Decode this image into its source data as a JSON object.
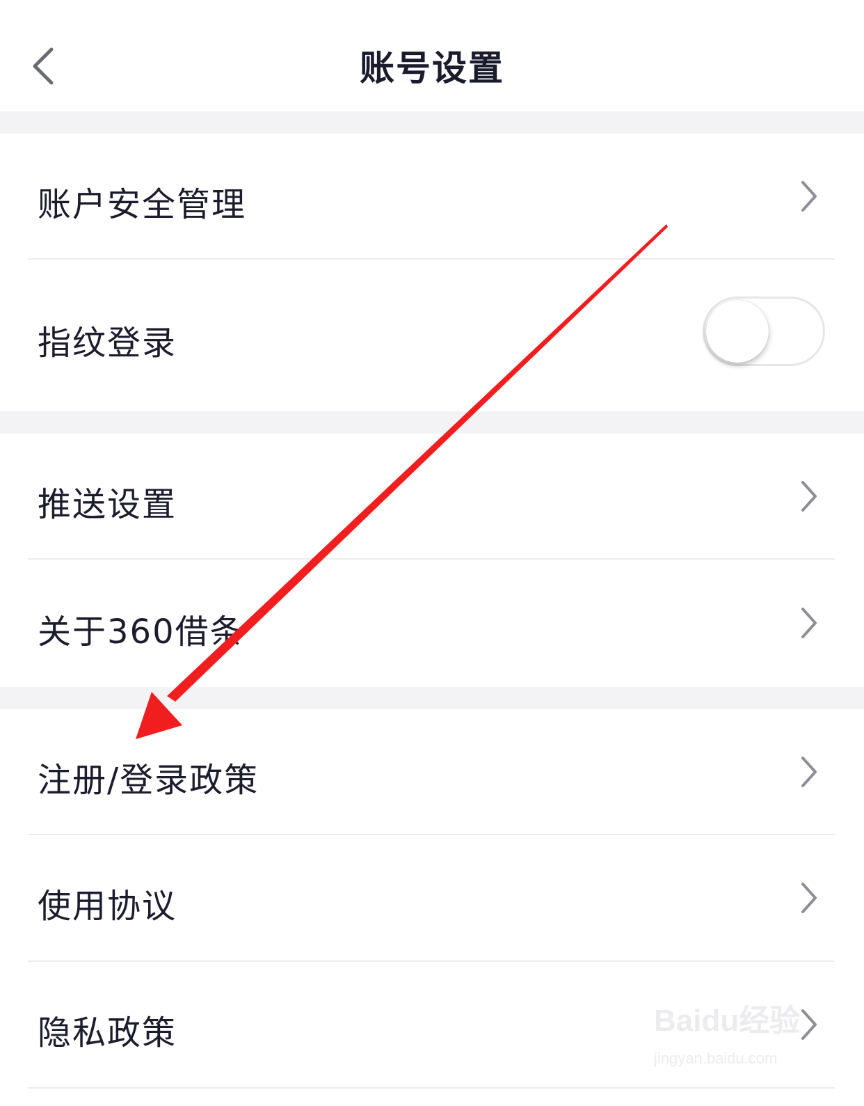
{
  "header": {
    "title": "账号设置",
    "back_icon": "chevron-left-icon"
  },
  "sections": [
    {
      "items": [
        {
          "label": "账户安全管理",
          "control": "chevron-right-icon"
        },
        {
          "label": "指纹登录",
          "control": "toggle",
          "toggle_on": false
        }
      ]
    },
    {
      "items": [
        {
          "label": "推送设置",
          "control": "chevron-right-icon"
        },
        {
          "label": "关于360借条",
          "control": "chevron-right-icon"
        }
      ]
    },
    {
      "items": [
        {
          "label": "注册/登录政策",
          "control": "chevron-right-icon"
        },
        {
          "label": "使用协议",
          "control": "chevron-right-icon"
        },
        {
          "label": "隐私政策",
          "control": "chevron-right-icon"
        }
      ]
    }
  ],
  "watermark": {
    "brand": "Baidu经验",
    "url": "jingyan.baidu.com"
  },
  "colors": {
    "title_text": "#1b1b2e",
    "row_text": "#1c1c2e",
    "section_gap": "#f3f3f6",
    "divider": "#ececf0",
    "chevron": "#8e8e96",
    "annotation_arrow": "#f01e1e"
  }
}
